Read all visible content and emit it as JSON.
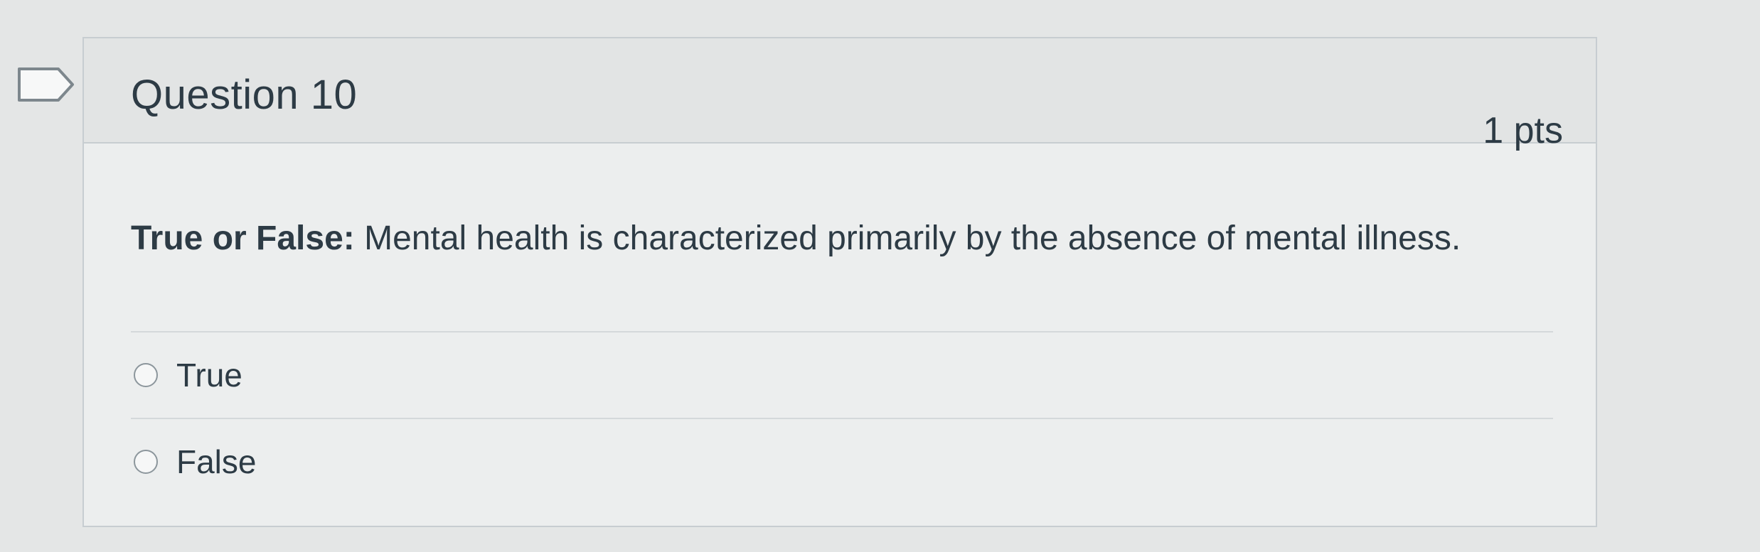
{
  "question": {
    "title": "Question 10",
    "points": "1 pts",
    "prompt_bold": "True or False:",
    "prompt_text": " Mental health is characterized primarily by the absence of mental illness."
  },
  "answers": [
    {
      "label": "True",
      "selected": false
    },
    {
      "label": "False",
      "selected": false
    }
  ],
  "icons": {
    "flag": "flag-question-icon"
  },
  "colors": {
    "page_background": "#e4e6e6",
    "card_border": "#c7cdd1",
    "text": "#2d3b45"
  }
}
